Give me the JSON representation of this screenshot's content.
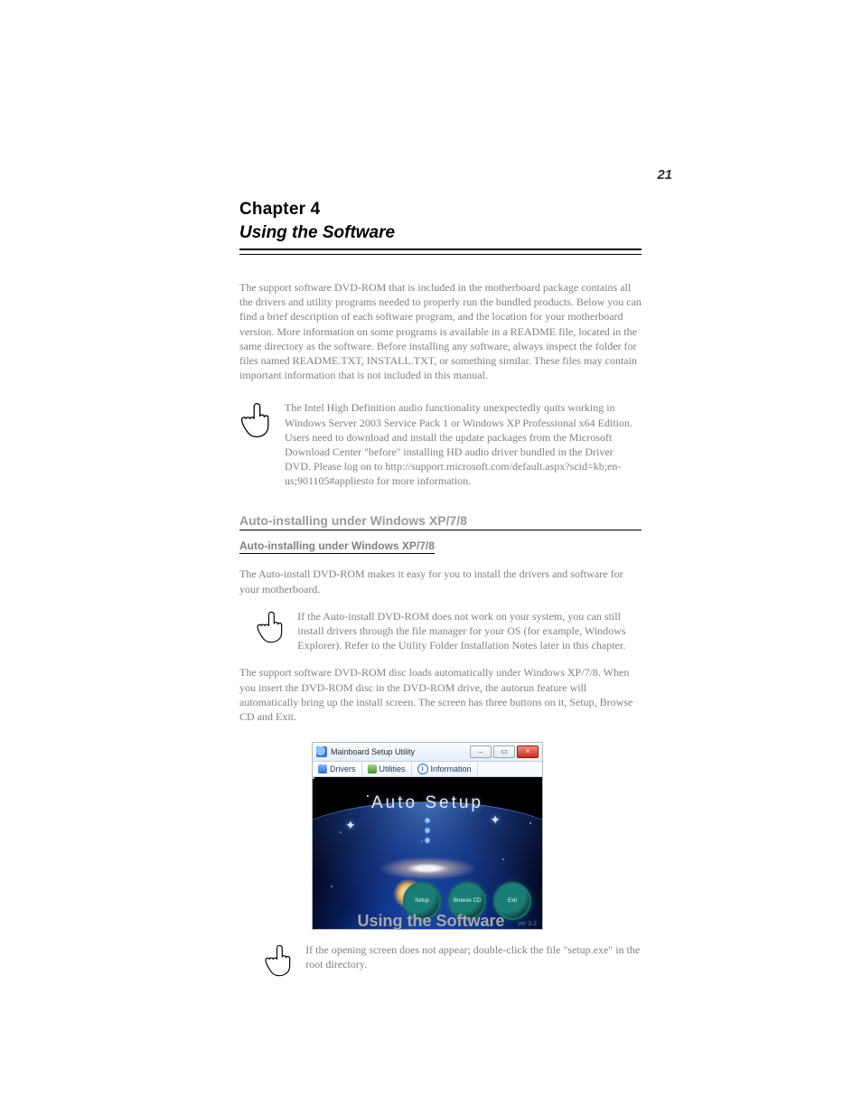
{
  "page_number": "21",
  "chapter_label": "Chapter 4",
  "chapter_title": "Using the Software",
  "intro": "The support software DVD-ROM that is included in the motherboard package contains all the drivers and utility programs needed to properly run the bundled products. Below you can find a brief description of each software program, and the location for your motherboard version. More information on some programs is available in a README file, located in the same directory as the software. Before installing any software, always inspect the folder for files named README.TXT, INSTALL.TXT, or something similar. These files may contain important information that is not included in this manual.",
  "note1": "The Intel High Definition audio functionality unexpectedly quits working in Windows Server 2003 Service Pack 1 or Windows XP Professional x64 Edition. Users need to download and install the update packages from the Microsoft Download Center \"before\" installing HD audio driver bundled in the Driver DVD. Please log on to http://support.microsoft.com/default.aspx?scid=kb;en-us;901105#appliesto for more information.",
  "section_title": "Auto-installing under Windows XP/7/8",
  "auto_install_body": "The Auto-install DVD-ROM makes it easy for you to install the drivers and software for your motherboard.",
  "note2": "If the Auto-install DVD-ROM does not work on your system, you can still install drivers through the file manager for your OS (for example, Windows Explorer). Refer to the Utility Folder Installation Notes later in this chapter.",
  "run_text": "The support software DVD-ROM disc loads automatically under Windows XP/7/8. When you insert the DVD-ROM disc in the DVD-ROM drive, the autorun feature will automatically bring up the install screen. The screen has three buttons on it, Setup, Browse CD and Exit.",
  "note3": "If the opening screen does not appear; double-click the file \"setup.exe\" in the root directory.",
  "footer_title": "Using the Software",
  "screenshot": {
    "window_title": "Mainboard Setup Utility",
    "tabs": {
      "drivers": "Drivers",
      "utilities": "Utilities",
      "information": "Information"
    },
    "headline": "Auto Setup",
    "buttons": {
      "setup": "Setup",
      "browse": "Browse CD",
      "exit": "Exit"
    },
    "version": "ver 3.2"
  }
}
